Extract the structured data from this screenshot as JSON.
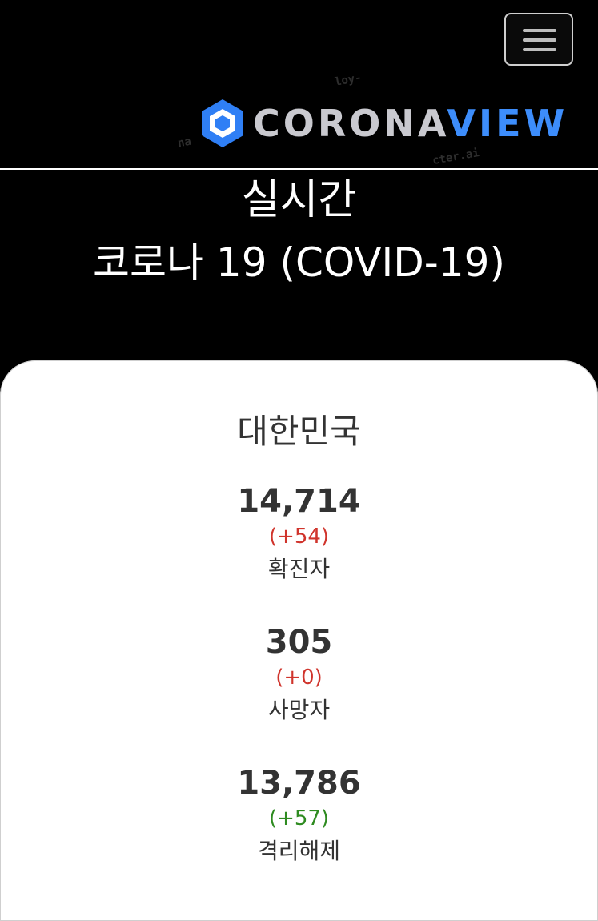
{
  "header": {
    "menu_icon": "hamburger-menu-icon",
    "logo": {
      "icon": "hexagon-logo-icon",
      "text_part1": "CORONA",
      "text_part2": "VIEW",
      "text_part1_color": "#c9c9cf",
      "text_part2_color": "#3d8dfb"
    }
  },
  "hero": {
    "line1": "실시간",
    "line2": "코로나 19 (COVID-19)"
  },
  "country": {
    "name": "대한민국",
    "stats": [
      {
        "value": "14,714",
        "change": "(+54)",
        "change_color": "#d0342c",
        "label": "확진자"
      },
      {
        "value": "305",
        "change": "(+0)",
        "change_color": "#d0342c",
        "label": "사망자"
      },
      {
        "value": "13,786",
        "change": "(+57)",
        "change_color": "#2e8b20",
        "label": "격리해제"
      }
    ]
  },
  "colors": {
    "background": "#000000",
    "card": "#ffffff",
    "text_dark": "#333333",
    "increase_red": "#d0342c",
    "recovered_green": "#2e8b20"
  }
}
